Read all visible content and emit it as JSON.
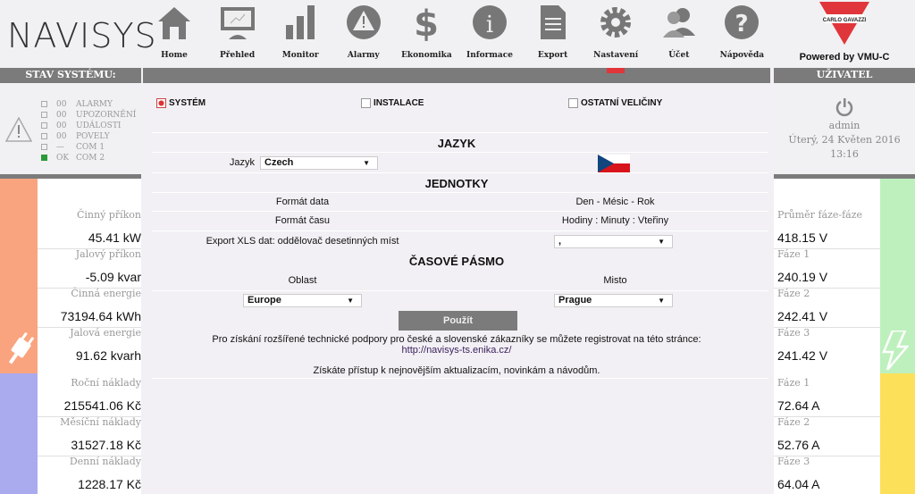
{
  "header": {
    "logo": "NAVISYS",
    "nav": [
      {
        "label": "Home",
        "icon": "home-icon"
      },
      {
        "label": "Přehled",
        "icon": "monitor-icon"
      },
      {
        "label": "Monitor",
        "icon": "bar-chart-icon"
      },
      {
        "label": "Alarmy",
        "icon": "warning-icon"
      },
      {
        "label": "Ekonomika",
        "icon": "dollar-icon"
      },
      {
        "label": "Informace",
        "icon": "info-icon"
      },
      {
        "label": "Export",
        "icon": "document-icon"
      },
      {
        "label": "Nastavení",
        "icon": "gear-icon"
      },
      {
        "label": "Účet",
        "icon": "users-icon"
      },
      {
        "label": "Nápověda",
        "icon": "help-icon"
      }
    ],
    "brand": "CARLO GAVAZZI",
    "powered": "Powered by  VMU-C"
  },
  "status": {
    "title": "STAV SYSTÉMU:",
    "rows": [
      {
        "count": "00",
        "label": "ALARMY",
        "ok": false
      },
      {
        "count": "00",
        "label": "UPOZORNĚNÍ",
        "ok": false
      },
      {
        "count": "00",
        "label": "UDÁLOSTI",
        "ok": false
      },
      {
        "count": "00",
        "label": "POVELY",
        "ok": false
      },
      {
        "count": "—",
        "label": "COM 1",
        "ok": false
      },
      {
        "count": "OK",
        "label": "COM 2",
        "ok": true
      }
    ]
  },
  "user": {
    "title": "UŽIVATEL",
    "name": "admin",
    "date": "Úterý, 24 Květen 2016",
    "time": "13:16"
  },
  "left": {
    "items": [
      {
        "label": "Činný příkon",
        "value": "45.41 kW"
      },
      {
        "label": "Jalový příkon",
        "value": "-5.09 kvar"
      },
      {
        "label": "Činná energie",
        "value": "73194.64 kWh"
      },
      {
        "label": "Jalová energie",
        "value": "91.62 kvarh"
      },
      {
        "label": "Roční náklady",
        "value": "215541.06 Kč"
      },
      {
        "label": "Měsíční náklady",
        "value": "31527.18 Kč"
      },
      {
        "label": "Denní náklady",
        "value": "1228.17 Kč"
      }
    ]
  },
  "right": {
    "items": [
      {
        "label": "Průměr fáze-fáze",
        "value": "418.15 V"
      },
      {
        "label": "Fáze 1",
        "value": "240.19 V"
      },
      {
        "label": "Fáze 2",
        "value": "242.41 V"
      },
      {
        "label": "Fáze 3",
        "value": "241.42 V"
      },
      {
        "label": "Fáze 1",
        "value": "72.64 A"
      },
      {
        "label": "Fáze 2",
        "value": "52.76 A"
      },
      {
        "label": "Fáze 3",
        "value": "64.04 A"
      }
    ]
  },
  "main": {
    "tabs": [
      {
        "label": "SYSTÉM",
        "checked": true
      },
      {
        "label": "INSTALACE",
        "checked": false
      },
      {
        "label": "OSTATNÍ VELIČINY",
        "checked": false
      }
    ],
    "jazyk_heading": "JAZYK",
    "jazyk_label": "Jazyk",
    "jazyk_value": "Czech",
    "units_heading": "JEDNOTKY",
    "date_label": "Formát data",
    "date_value": "Den - Mésic - Rok",
    "time_label": "Formát času",
    "time_value": "Hodiny : Minuty : Vteřiny",
    "xls_label": "Export XLS dat: oddělovač desetinných míst",
    "xls_value": ",",
    "tz_heading": "ČASOVÉ PÁSMO",
    "area_label": "Oblast",
    "area_value": "Europe",
    "place_label": "Misto",
    "place_value": "Prague",
    "apply": "Použít",
    "support_text": "Pro získání rozšířené technické podpory pro české a slovenské zákazníky se můžete registrovat na této stránce:",
    "support_link": "http://navisys-ts.enika.cz/",
    "updates_text": "Získáte přístup k nejnovějším aktualizacím, novinkám a návodům."
  },
  "colors": {
    "power": "#f9a47f",
    "cost": "#aaaaee",
    "voltage": "#bdf0bd",
    "current": "#fde05a",
    "bar": "#7b7b7b",
    "accent": "#e0353a"
  }
}
